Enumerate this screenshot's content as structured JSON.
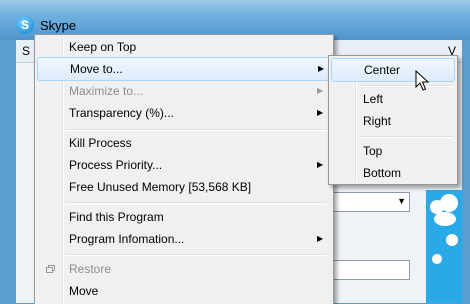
{
  "window": {
    "title": "Skype",
    "icon": "skype-logo-icon",
    "menubar_left": "S",
    "menubar_right": "V"
  },
  "main_menu": {
    "items": [
      {
        "label": "Keep on Top"
      },
      {
        "label": "Move to...",
        "submenu": true,
        "highlighted": true
      },
      {
        "label": "Maximize to...",
        "submenu": true,
        "disabled": true
      },
      {
        "label": "Transparency (%)...",
        "submenu": true
      },
      {
        "label": "Kill Process"
      },
      {
        "label": "Process Priority...",
        "submenu": true
      },
      {
        "label": "Free Unused Memory [53,568 KB]"
      },
      {
        "label": "Find this Program"
      },
      {
        "label": "Program Infomation...",
        "submenu": true
      },
      {
        "label": "Restore",
        "disabled": true,
        "icon": "restore-icon"
      },
      {
        "label": "Move"
      }
    ]
  },
  "submenu": {
    "items": [
      {
        "label": "Center",
        "highlighted": true
      },
      {
        "label": "Left"
      },
      {
        "label": "Right"
      },
      {
        "label": "Top"
      },
      {
        "label": "Bottom"
      }
    ]
  },
  "colors": {
    "highlight_border": "#a8d8f8",
    "menu_bg": "#f0f0f0",
    "title_bar": "#6fb0df",
    "skype_blue": "#2aa9e8"
  }
}
